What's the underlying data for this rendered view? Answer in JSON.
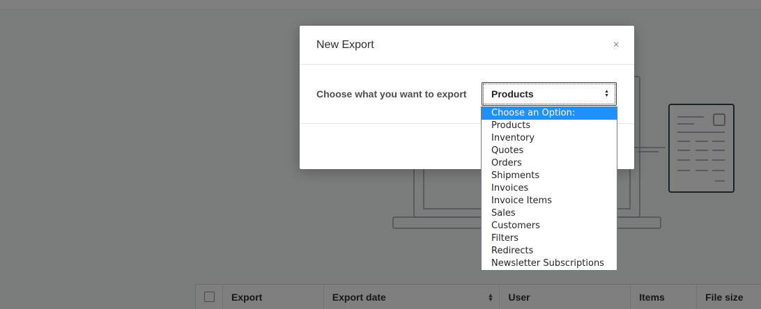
{
  "modal": {
    "title": "New Export",
    "close_symbol": "×",
    "field_label": "Choose what you want to export",
    "selected_value": "Products"
  },
  "dropdown": {
    "options": [
      "Choose an Option:",
      "Products",
      "Inventory",
      "Quotes",
      "Orders",
      "Shipments",
      "Invoices",
      "Invoice Items",
      "Sales",
      "Customers",
      "Filters",
      "Redirects",
      "Newsletter Subscriptions"
    ],
    "highlighted_index": 0,
    "highlight_color": "#1e90ff"
  },
  "table": {
    "headers": [
      "Export",
      "Export date",
      "User",
      "Items",
      "File size"
    ]
  }
}
